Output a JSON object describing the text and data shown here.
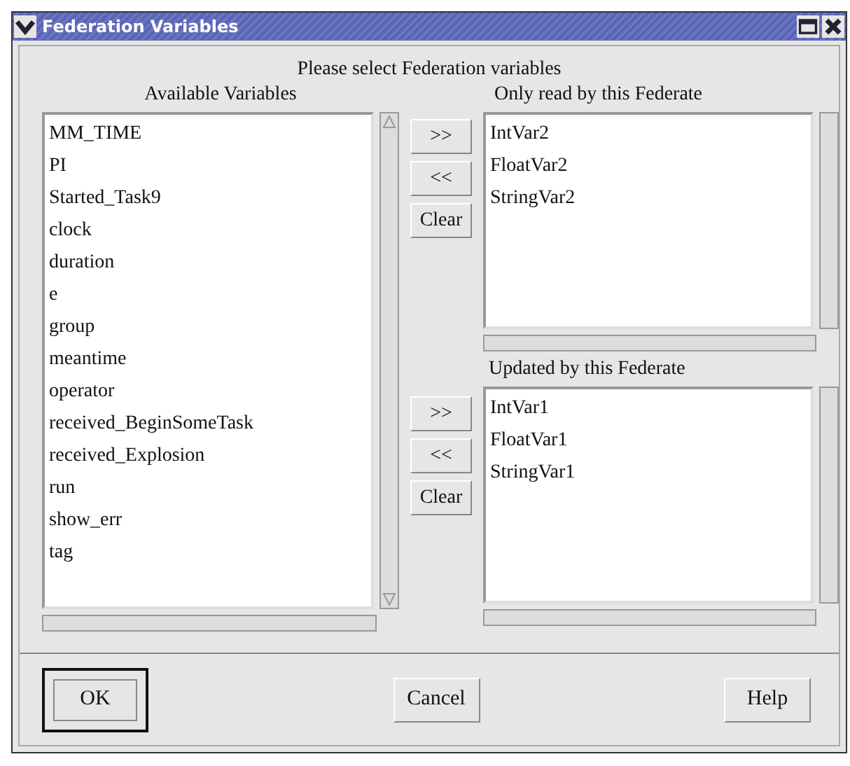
{
  "window": {
    "title": "Federation Variables"
  },
  "heading": "Please select Federation variables",
  "available": {
    "label": "Available Variables",
    "items": [
      "MM_TIME",
      "PI",
      "Started_Task9",
      "clock",
      "duration",
      "e",
      "group",
      "meantime",
      "operator",
      "received_BeginSomeTask",
      "received_Explosion",
      "run",
      "show_err",
      "tag"
    ]
  },
  "targets": [
    {
      "label": "Only read by this Federate",
      "items": [
        "IntVar2",
        "FloatVar2",
        "StringVar2"
      ],
      "buttons": [
        ">>",
        "<<",
        "Clear"
      ]
    },
    {
      "label": "Updated by this Federate",
      "items": [
        "IntVar1",
        "FloatVar1",
        "StringVar1"
      ],
      "buttons": [
        ">>",
        "<<",
        "Clear"
      ]
    }
  ],
  "footer": [
    {
      "label": "OK",
      "default": true
    },
    {
      "label": "Cancel",
      "default": false
    },
    {
      "label": "Help",
      "default": false
    }
  ]
}
